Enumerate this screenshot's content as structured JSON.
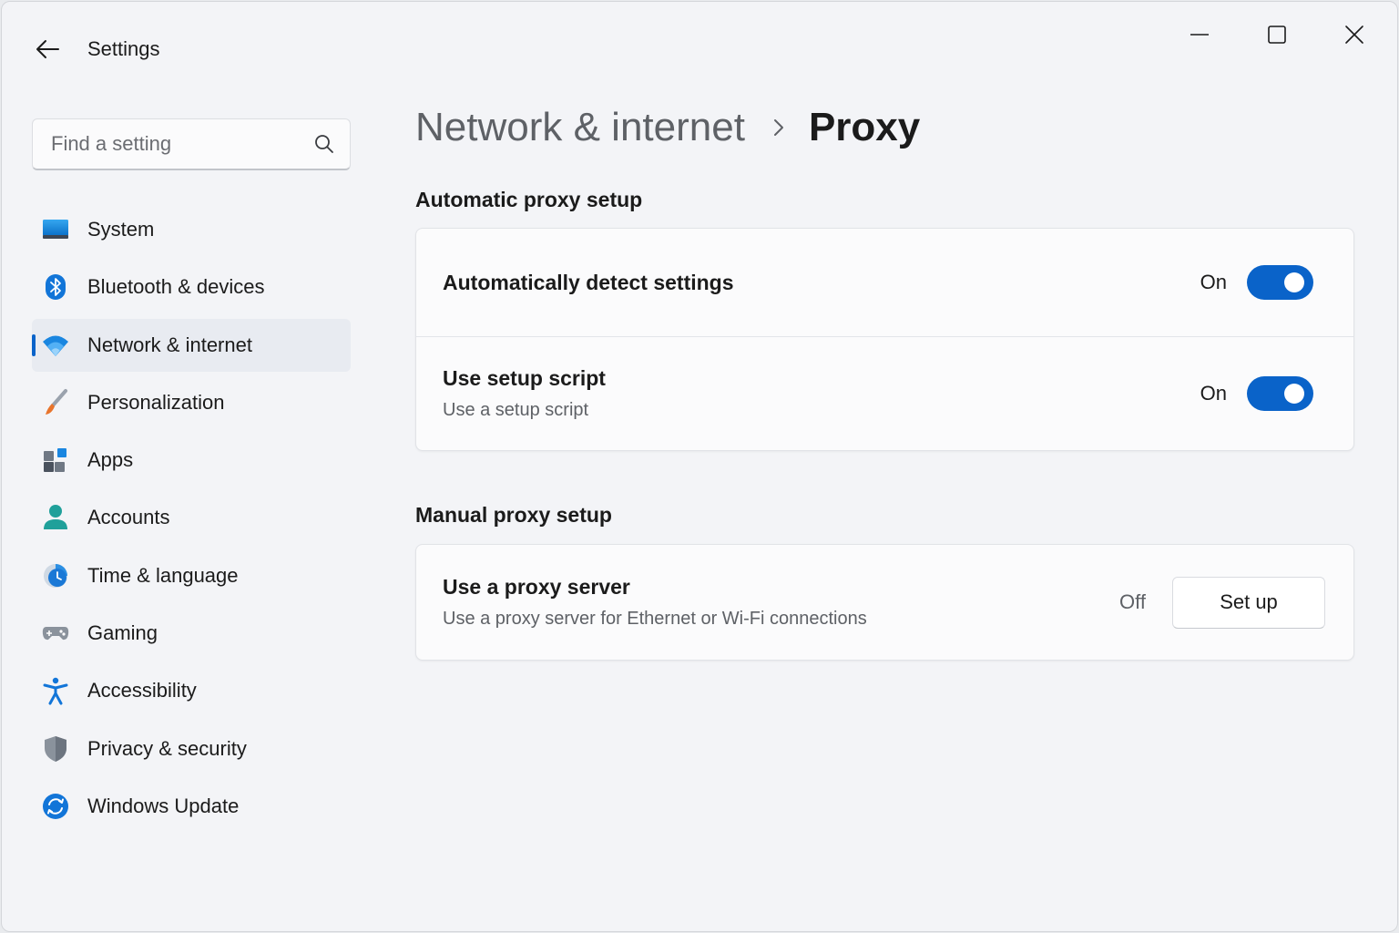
{
  "window": {
    "title": "Settings",
    "controls": {
      "minimize": "minimize",
      "maximize": "maximize",
      "close": "close"
    }
  },
  "search": {
    "value": "",
    "placeholder": "Find a setting"
  },
  "sidebar": {
    "active_index": 2,
    "items": [
      {
        "label": "System",
        "icon": "system-monitor-icon"
      },
      {
        "label": "Bluetooth & devices",
        "icon": "bluetooth-icon"
      },
      {
        "label": "Network & internet",
        "icon": "wifi-icon"
      },
      {
        "label": "Personalization",
        "icon": "paintbrush-icon"
      },
      {
        "label": "Apps",
        "icon": "apps-grid-icon"
      },
      {
        "label": "Accounts",
        "icon": "person-icon"
      },
      {
        "label": "Time & language",
        "icon": "globe-clock-icon"
      },
      {
        "label": "Gaming",
        "icon": "gamepad-icon"
      },
      {
        "label": "Accessibility",
        "icon": "accessibility-icon"
      },
      {
        "label": "Privacy & security",
        "icon": "shield-icon"
      },
      {
        "label": "Windows Update",
        "icon": "update-sync-icon"
      }
    ]
  },
  "breadcrumb": {
    "parent": "Network & internet",
    "current": "Proxy"
  },
  "automatic": {
    "title": "Automatic proxy setup",
    "detect": {
      "title": "Automatically detect settings",
      "state": "On",
      "enabled": true
    },
    "script": {
      "title": "Use setup script",
      "subtitle": "Use a setup script",
      "state": "On",
      "enabled": true
    }
  },
  "manual": {
    "title": "Manual proxy setup",
    "server": {
      "title": "Use a proxy server",
      "subtitle": "Use a proxy server for Ethernet or Wi-Fi connections",
      "state": "Off",
      "button": "Set up"
    }
  },
  "colors": {
    "accent": "#0a63c9",
    "background": "#f3f4f7",
    "card": "#fbfbfc"
  }
}
